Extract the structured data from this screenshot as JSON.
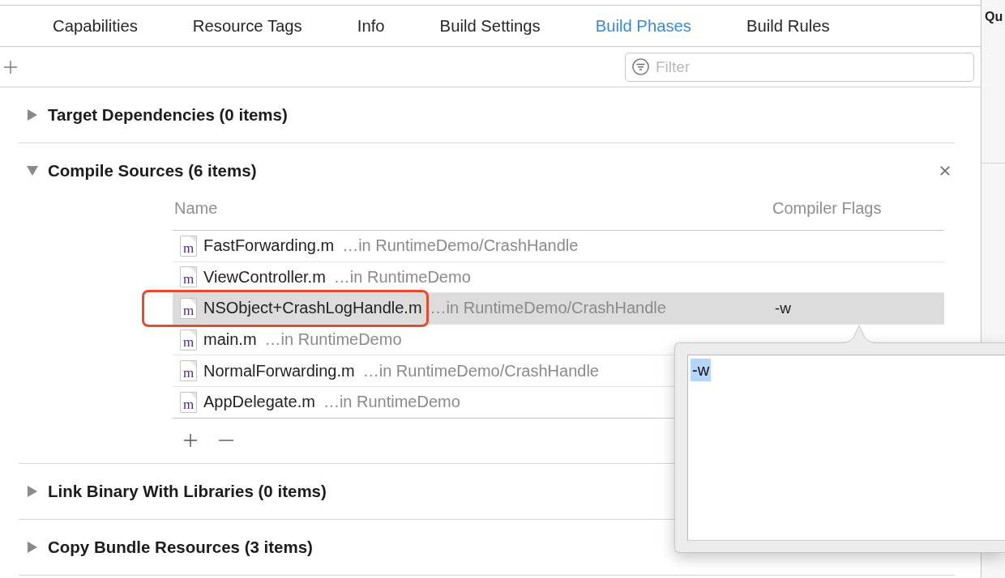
{
  "tabs": [
    {
      "label": "Capabilities",
      "selected": false
    },
    {
      "label": "Resource Tags",
      "selected": false
    },
    {
      "label": "Info",
      "selected": false
    },
    {
      "label": "Build Settings",
      "selected": false
    },
    {
      "label": "Build Phases",
      "selected": true
    },
    {
      "label": "Build Rules",
      "selected": false
    }
  ],
  "filter": {
    "placeholder": "Filter"
  },
  "phases": [
    {
      "title": "Target Dependencies (0 items)",
      "expanded": false,
      "closable": false
    },
    {
      "title": "Compile Sources (6 items)",
      "expanded": true,
      "closable": true,
      "table": {
        "columns": [
          "Name",
          "Compiler Flags"
        ],
        "rows": [
          {
            "icon_label": "m",
            "name": "FastForwarding.m",
            "location": "…in RuntimeDemo/CrashHandle",
            "selected": false,
            "annotated": false
          },
          {
            "icon_label": "m",
            "name": "ViewController.m",
            "location": "…in RuntimeDemo",
            "selected": false,
            "annotated": false
          },
          {
            "icon_label": "m",
            "name": "NSObject+CrashLogHandle.m",
            "location": "…in RuntimeDemo/CrashHandle",
            "flags": "-w",
            "selected": true,
            "annotated": true
          },
          {
            "icon_label": "m",
            "name": "main.m",
            "location": "…in RuntimeDemo",
            "selected": false,
            "annotated": false
          },
          {
            "icon_label": "m",
            "name": "NormalForwarding.m",
            "location": "…in RuntimeDemo/CrashHandle",
            "selected": false,
            "annotated": false
          },
          {
            "icon_label": "m",
            "name": "AppDelegate.m",
            "location": "…in RuntimeDemo",
            "selected": false,
            "annotated": false
          }
        ]
      }
    },
    {
      "title": "Link Binary With Libraries (0 items)",
      "expanded": false,
      "closable": false
    },
    {
      "title": "Copy Bundle Resources (3 items)",
      "expanded": false,
      "closable": false
    }
  ],
  "flags_popover": {
    "value": "-w",
    "text_selected": true
  },
  "inspector": {
    "title": "Qu"
  }
}
